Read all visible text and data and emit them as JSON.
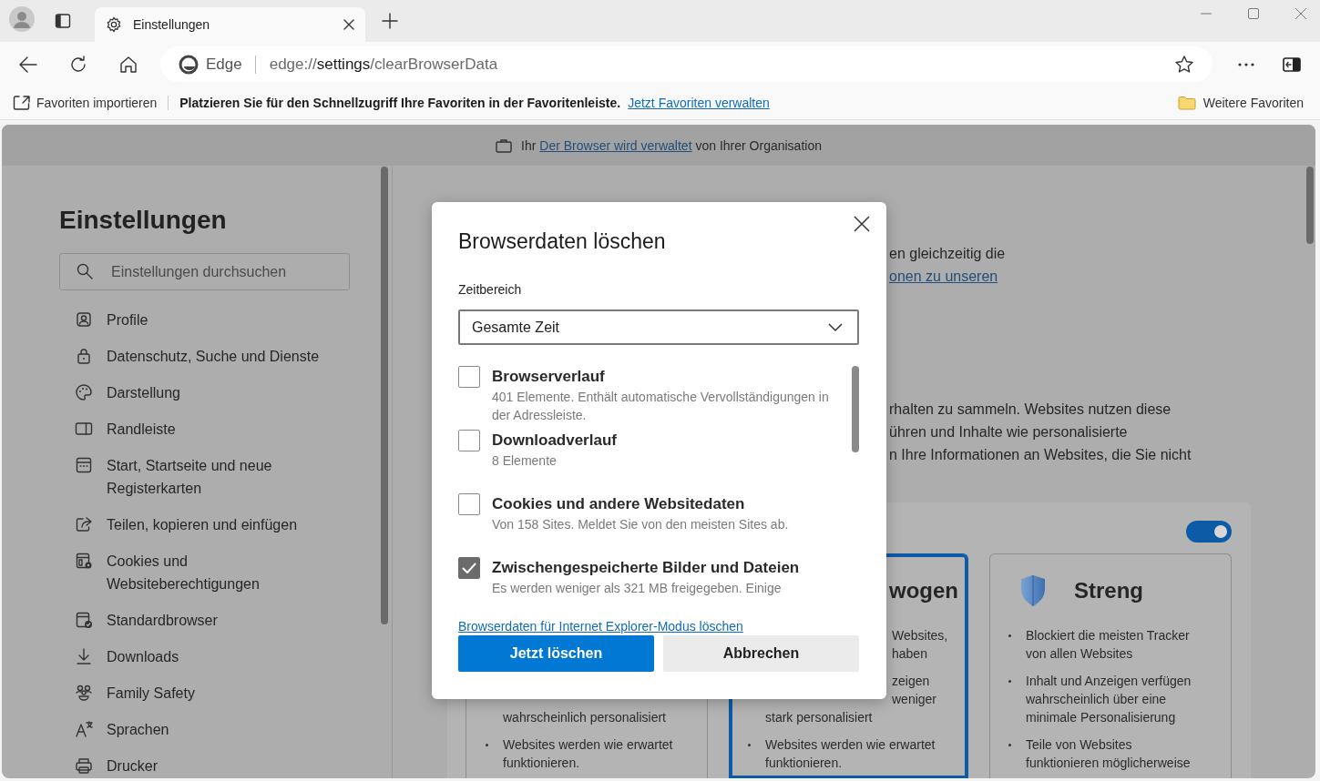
{
  "tab_strip": {
    "tab": {
      "title": "Einstellungen"
    }
  },
  "toolbar": {
    "site_label": "Edge",
    "url": "edge://**settings**/clearBrowserData"
  },
  "favorites_bar": {
    "import_label": "Favoriten importieren",
    "message": "Platzieren Sie für den Schnellzugriff Ihre Favoriten in der Favoritenleiste.",
    "link": "Jetzt Favoriten verwalten",
    "other_favorites": "Weitere Favoriten"
  },
  "banner": {
    "prefix": "Ihr",
    "link": "Der Browser wird verwaltet",
    "suffix": "von Ihrer Organisation"
  },
  "sidebar": {
    "title": "Einstellungen",
    "search": {
      "placeholder": "Einstellungen durchsuchen"
    },
    "items": [
      {
        "label": "Profile"
      },
      {
        "label": "Datenschutz, Suche und Dienste"
      },
      {
        "label": "Darstellung"
      },
      {
        "label": "Randleiste"
      },
      {
        "label": "Start, Startseite und neue Registerkarten"
      },
      {
        "label": "Teilen, kopieren und einfügen"
      },
      {
        "label": "Cookies und Websiteberechtigungen"
      },
      {
        "label": "Standardbrowser"
      },
      {
        "label": "Downloads"
      },
      {
        "label": "Family Safety"
      },
      {
        "label": "Sprachen"
      },
      {
        "label": "Drucker"
      }
    ]
  },
  "main": {
    "intro_fragments": [
      {
        "text": "en gleichzeitig die",
        "kind": "text"
      },
      {
        "text": "onen zu unseren",
        "kind": "link"
      }
    ],
    "tracking_fragments": [
      "rhalten zu sammeln. Websites nutzen diese",
      "ühren und Inhalte wie personalisierte",
      "n Ihre Informationen an Websites, die Sie nicht"
    ],
    "tracking_prevention": {
      "on": true,
      "cards": [
        {
          "selected": false,
          "groups": [
            {
              "lines": [
                {
                  "text": "wahrscheinlich personalisiert",
                  "kind": "line"
                }
              ]
            },
            {
              "marker": true,
              "lines": [
                {
                  "text": "Websites werden wie erwartet funktionieren.",
                  "kind": "line"
                }
              ]
            }
          ]
        },
        {
          "selected": true,
          "header": {
            "kind": "fragment",
            "title": "wogen"
          },
          "groups": [
            {
              "lines": [
                {
                  "text": "Websites,",
                  "kind": "fragment"
                },
                {
                  "text": "haben",
                  "kind": "fragment"
                }
              ]
            },
            {
              "lines": [
                {
                  "text": "zeigen",
                  "kind": "fragment"
                },
                {
                  "text": "weniger",
                  "kind": "fragment"
                },
                {
                  "text": "stark personalisiert",
                  "kind": "line"
                }
              ]
            },
            {
              "marker": true,
              "lines": [
                {
                  "text": "Websites werden wie erwartet funktionieren.",
                  "kind": "line"
                }
              ]
            }
          ]
        },
        {
          "selected": false,
          "header": {
            "kind": "full",
            "title": "Streng"
          },
          "groups": [
            {
              "marker": true,
              "lines": [
                {
                  "text": "Blockiert die meisten Tracker von allen Websites",
                  "kind": "line"
                }
              ]
            },
            {
              "marker": true,
              "lines": [
                {
                  "text": "Inhalt und Anzeigen verfügen wahrscheinlich über eine minimale Personalisierung",
                  "kind": "line"
                }
              ]
            },
            {
              "marker": true,
              "lines": [
                {
                  "text": "Teile von Websites funktionieren möglicherweise",
                  "kind": "line"
                }
              ]
            }
          ]
        }
      ]
    }
  },
  "dialog": {
    "title": "Browserdaten löschen",
    "time_range": {
      "label": "Zeitbereich",
      "value": "Gesamte Zeit"
    },
    "options": [
      {
        "label": "Browserverlauf",
        "description": "401 Elemente. Enthält automatische Vervollständigungen in der Adressleiste.",
        "checked": false
      },
      {
        "label": "Downloadverlauf",
        "description": "8 Elemente",
        "checked": false
      },
      {
        "label": "Cookies und andere Websitedaten",
        "description": "Von 158 Sites. Meldet Sie von den meisten Sites ab.",
        "checked": false
      },
      {
        "label": "Zwischengespeicherte Bilder und Dateien",
        "description": "Es werden weniger als 321 MB freigegeben. Einige",
        "checked": true
      }
    ],
    "ie_link": "Browserdaten für Internet Explorer-Modus löschen",
    "buttons": [
      {
        "label": "Jetzt löschen",
        "kind": "primary"
      },
      {
        "label": "Abbrechen",
        "kind": "secondary"
      }
    ]
  }
}
